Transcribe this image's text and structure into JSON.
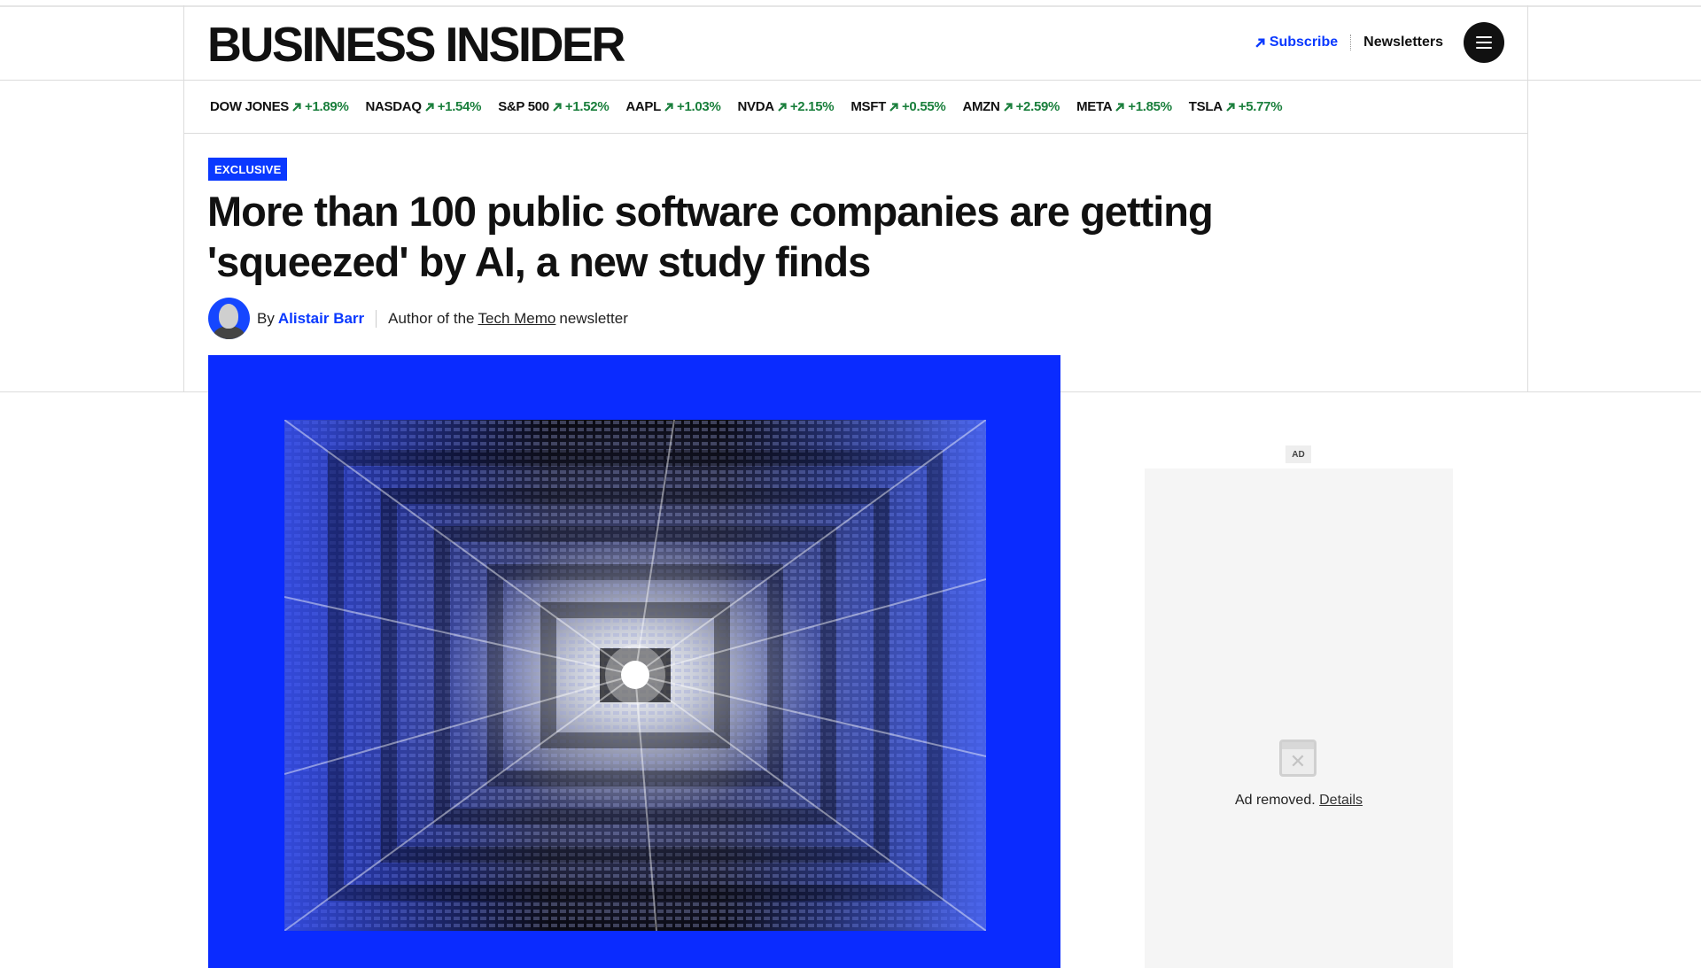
{
  "header": {
    "logo": "BUSINESS INSIDER",
    "subscribe_label": "Subscribe",
    "newsletters_label": "Newsletters"
  },
  "ticker": [
    {
      "symbol": "DOW JONES",
      "change": "+1.89%"
    },
    {
      "symbol": "NASDAQ",
      "change": "+1.54%"
    },
    {
      "symbol": "S&P 500",
      "change": "+1.52%"
    },
    {
      "symbol": "AAPL",
      "change": "+1.03%"
    },
    {
      "symbol": "NVDA",
      "change": "+2.15%"
    },
    {
      "symbol": "MSFT",
      "change": "+0.55%"
    },
    {
      "symbol": "AMZN",
      "change": "+2.59%"
    },
    {
      "symbol": "META",
      "change": "+1.85%"
    },
    {
      "symbol": "TSLA",
      "change": "+5.77%"
    }
  ],
  "article": {
    "badge": "EXCLUSIVE",
    "headline_line1": "More than 100 public software companies are getting",
    "headline_line2": "'squeezed' by AI, a new study finds",
    "byline_prefix": "By",
    "author": "Alistair Barr",
    "author_role_prefix": "Author of the",
    "newsletter_name": "Tech Memo",
    "author_role_suffix": "newsletter"
  },
  "ad": {
    "label": "AD",
    "removed_text": "Ad removed.",
    "details_link": "Details"
  },
  "colors": {
    "brand_blue": "#0a39ff",
    "ticker_green": "#1a7f3c",
    "hero_blue": "#0a2bff"
  }
}
